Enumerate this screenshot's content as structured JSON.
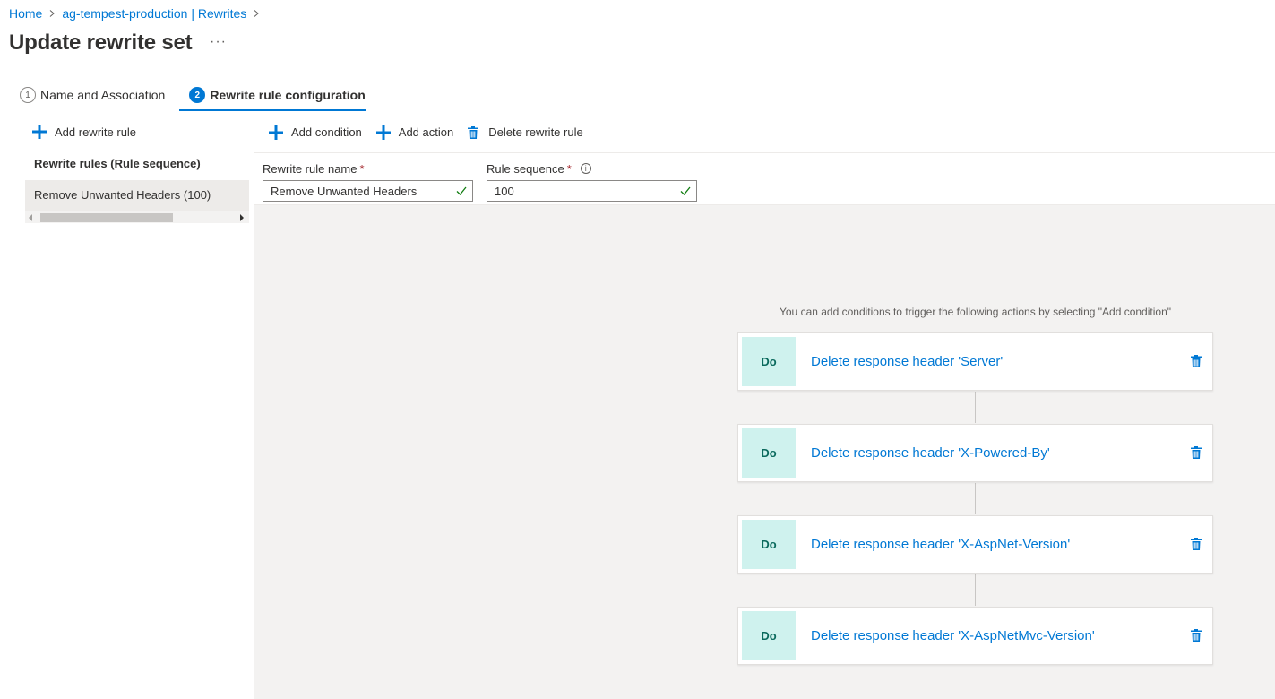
{
  "breadcrumb": {
    "home": "Home",
    "resource": "ag-tempest-production | Rewrites"
  },
  "page": {
    "title": "Update rewrite set",
    "more": "···"
  },
  "tabs": [
    {
      "num": "1",
      "label": "Name and Association"
    },
    {
      "num": "2",
      "label": "Rewrite rule configuration"
    }
  ],
  "left": {
    "add_rule_label": "Add rewrite rule",
    "rules_header": "Rewrite rules (Rule sequence)",
    "rules": [
      "Remove Unwanted Headers (100)"
    ]
  },
  "toolbar": {
    "add_condition": "Add condition",
    "add_action": "Add action",
    "delete_rule": "Delete rewrite rule"
  },
  "form": {
    "rule_name_label": "Rewrite rule name",
    "rule_name_value": "Remove Unwanted Headers",
    "sequence_label": "Rule sequence",
    "sequence_value": "100",
    "required_mark": "*",
    "info_glyph": "i"
  },
  "hint": "You can add conditions to trigger the following actions by selecting \"Add condition\"",
  "actions": [
    {
      "do": "Do",
      "label": "Delete response header 'Server'"
    },
    {
      "do": "Do",
      "label": "Delete response header 'X-Powered-By'"
    },
    {
      "do": "Do",
      "label": "Delete response header 'X-AspNet-Version'"
    },
    {
      "do": "Do",
      "label": "Delete response header 'X-AspNetMvc-Version'"
    }
  ],
  "colors": {
    "accent": "#0078d4",
    "do_bg": "#cff2ee",
    "success_check": "#107c10",
    "required": "#a4262c"
  }
}
